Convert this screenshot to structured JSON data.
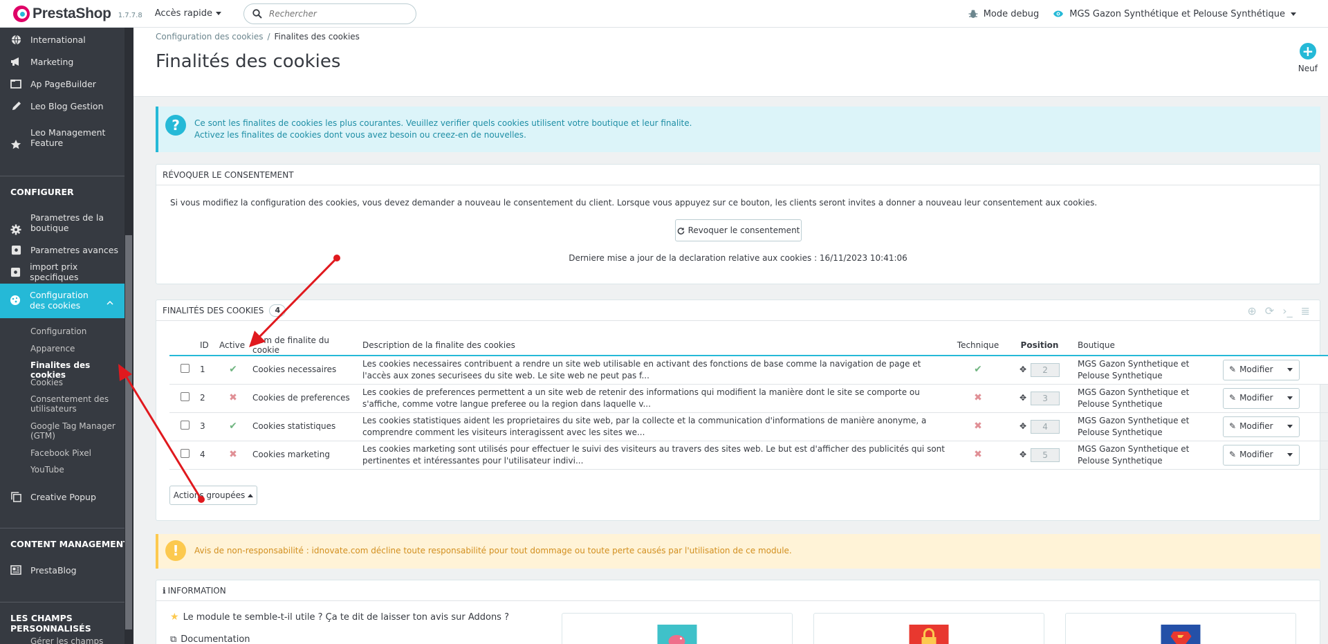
{
  "header": {
    "logo_text": "PrestaShop",
    "version": "1.7.7.8",
    "quick_access": "Accès rapide",
    "search_placeholder": "Rechercher",
    "debug": "Mode debug",
    "shop": "MGS Gazon Synthétique et Pelouse Synthétique"
  },
  "sidebar": {
    "items_top": [
      {
        "label": "International",
        "icon": "globe-icon"
      },
      {
        "label": "Marketing",
        "icon": "megaphone-icon"
      },
      {
        "label": "Ap PageBuilder",
        "icon": "folder-icon"
      },
      {
        "label": "Leo Blog Gestion",
        "icon": "pencil-icon"
      },
      {
        "label": "Leo Management Feature",
        "icon": "star-icon"
      }
    ],
    "section_configurer": "CONFIGURER",
    "items_config": [
      {
        "label": "Parametres de la boutique",
        "icon": "gear-icon"
      },
      {
        "label": "Parametres avances",
        "icon": "puzzle-icon"
      },
      {
        "label": "import prix specifiques",
        "icon": "puzzle-icon"
      }
    ],
    "active_item": "Configuration des cookies",
    "sub_items": [
      "Configuration",
      "Apparence",
      "Finalites des cookies",
      "Cookies",
      "Consentement des utilisateurs",
      "Google Tag Manager (GTM)",
      "Facebook Pixel",
      "YouTube"
    ],
    "creative_popup": "Creative Popup",
    "section_content": "CONTENT MANAGEMENT",
    "prestablog": "PrestaBlog",
    "section_champs": "LES CHAMPS PERSONNALISÉS",
    "gerer_champs": "Gérer les champs"
  },
  "page": {
    "breadcrumb_parent": "Configuration des cookies",
    "breadcrumb_current": "Finalites des cookies",
    "title": "Finalités des cookies",
    "new_label": "Neuf"
  },
  "info_alert": {
    "line1": "Ce sont les finalites de cookies les plus courantes. Veuillez verifier quels cookies utilisent votre boutique et leur finalite.",
    "line2": "Activez les finalites de cookies dont vous avez besoin ou creez-en de nouvelles."
  },
  "revoke_panel": {
    "heading": "RÉVOQUER LE CONSENTEMENT",
    "text": "Si vous modifiez la configuration des cookies, vous devez demander a nouveau le consentement du client. Lorsque vous appuyez sur ce bouton, les clients seront invites a donner a nouveau leur consentement aux cookies.",
    "button": "Revoquer le consentement",
    "last_update": "Derniere mise a jour de la declaration relative aux cookies : 16/11/2023 10:41:06"
  },
  "list_panel": {
    "heading": "FINALITÉS DES COOKIES",
    "count": "4",
    "columns": [
      "ID",
      "Active",
      "Nom de finalite du cookie",
      "Description de la finalite des cookies",
      "Technique",
      "Position",
      "Boutique"
    ],
    "rows": [
      {
        "id": "1",
        "active": true,
        "name": "Cookies necessaires",
        "desc": "Les cookies necessaires contribuent a rendre un site web utilisable en activant des fonctions de base comme la navigation de page et l'accès aux zones securisees du site web. Le site web ne peut pas f...",
        "technique": true,
        "position": "2",
        "shop": "MGS Gazon Synthetique et Pelouse Synthetique",
        "action": "Modifier"
      },
      {
        "id": "2",
        "active": false,
        "name": "Cookies de preferences",
        "desc": "Les cookies de preferences permettent a un site web de retenir des informations qui modifient la manière dont le site se comporte ou s'affiche, comme votre langue preferee ou la region dans laquelle v...",
        "technique": false,
        "position": "3",
        "shop": "MGS Gazon Synthetique et Pelouse Synthetique",
        "action": "Modifier"
      },
      {
        "id": "3",
        "active": true,
        "name": "Cookies statistiques",
        "desc": "Les cookies statistiques aident les proprietaires du site web, par la collecte et la communication d'informations de manière anonyme, a comprendre comment les visiteurs interagissent avec les sites we...",
        "technique": false,
        "position": "4",
        "shop": "MGS Gazon Synthetique et Pelouse Synthetique",
        "action": "Modifier"
      },
      {
        "id": "4",
        "active": false,
        "name": "Cookies marketing",
        "desc": "Les cookies marketing sont utilisés pour effectuer le suivi des visiteurs au travers des sites web. Le but est d'afficher des publicités qui sont pertinentes et intéressantes pour l'utilisateur indivi...",
        "technique": false,
        "position": "5",
        "shop": "MGS Gazon Synthetique et Pelouse Synthetique",
        "action": "Modifier"
      }
    ],
    "bulk_actions": "Actions groupées"
  },
  "warn_alert": {
    "text": "Avis de non-responsabilité : idnovate.com décline toute responsabilité pour tout dommage ou toute perte causés par l'utilisation de ce module."
  },
  "info_panel": {
    "heading": "INFORMATION",
    "review_text": "Le module te semble-t-il utile ? Ça te dit de laisser ton avis sur Addons ?",
    "documentation": "Documentation"
  },
  "colors": {
    "accent": "#25b9d7",
    "sidebar_bg": "#363a41",
    "success": "#70b580",
    "danger": "#e08f95",
    "warning": "#fcc94f",
    "annotation": "#e0191e"
  }
}
